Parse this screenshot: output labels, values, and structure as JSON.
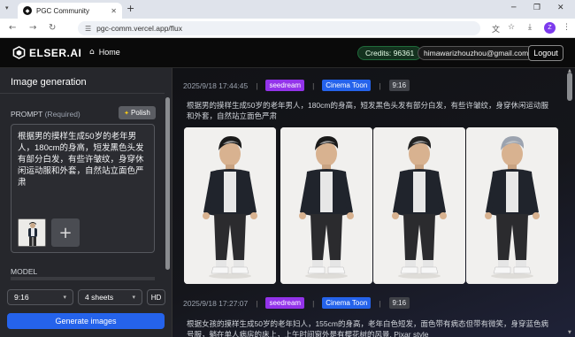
{
  "browser": {
    "tab_title": "PGC Community",
    "url": "pgc-comm.vercel.app/flux",
    "profile_initial": "Z"
  },
  "header": {
    "logo_text": "ELSER.AI",
    "home_label": "Home",
    "credits_label": "Credits: 96361",
    "email": "himawarizhouzhou@gmail.com",
    "logout_label": "Logout"
  },
  "sidebar": {
    "title": "Image generation",
    "prompt_label": "PROMPT",
    "prompt_required": "(Required)",
    "polish_label": "Polish",
    "prompt_text": "根据男的摸样生成50岁的老年男人，180cm的身高，短发黑色头发有部分白发，有些许皱纹，身穿休闲运动服和外套，自然站立面色严肃",
    "model_label": "MODEL",
    "aspect_ratio": "9:16",
    "sheets": "4 sheets",
    "hd_label": "HD",
    "generate_label": "Generate images"
  },
  "results": [
    {
      "timestamp": "2025/9/18 17:44:45",
      "model_tag": "seedream",
      "style_tag": "Cinema Toon",
      "ratio_tag": "9:16",
      "prompt": "根据男的摸样生成50岁的老年男人，180cm的身高，短发黑色头发有部分白发，有些许皱纹，身穿休闲运动服和外套，自然站立面色严肃"
    },
    {
      "timestamp": "2025/9/18 17:27:07",
      "model_tag": "seedream",
      "style_tag": "Cinema Toon",
      "ratio_tag": "9:16",
      "prompt": "根据女孩的摸样生成50岁的老年妇人，155cm的身高，老年白色短发，面色带有病态但带有微笑，身穿蓝色病号服，躺在单人病房的床上，上午时间窗外是有樱花树的风景, Pixar style"
    }
  ],
  "colors": {
    "accent": "#2563eb",
    "seedream_tag": "#9333ea",
    "credits_bg": "#14321f"
  }
}
